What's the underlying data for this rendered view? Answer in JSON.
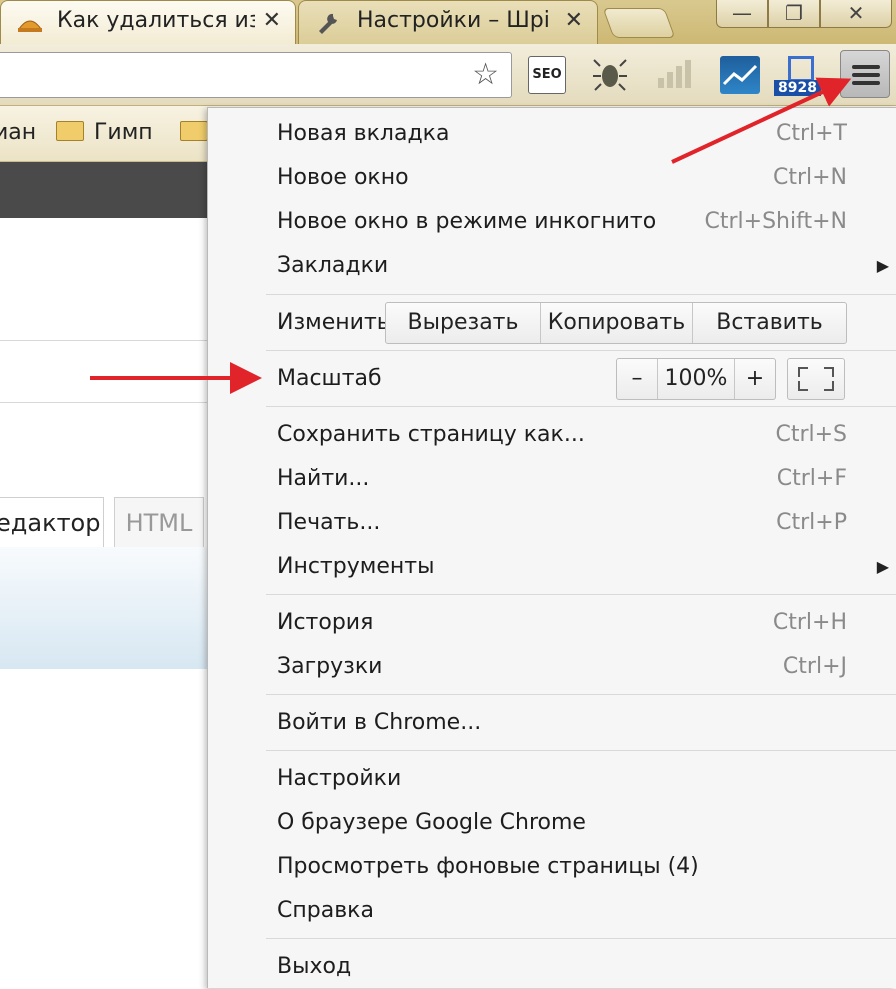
{
  "browser": {
    "tabs": [
      {
        "title": "Как удалиться из",
        "close": "✕",
        "active": true,
        "icon": "hat-favicon-icon"
      },
      {
        "title": "Настройки – Шрі",
        "close": "✕",
        "active": false,
        "icon": "wrench-icon"
      }
    ],
    "window_controls": {
      "minimize": "—",
      "restore": "❐",
      "close": "✕"
    }
  },
  "toolbar": {
    "extensions": [
      {
        "name": "seo-extension-icon",
        "label": "SEO"
      },
      {
        "name": "bug-extension-icon"
      },
      {
        "name": "signal-bars-extension-icon"
      },
      {
        "name": "chart-extension-icon"
      },
      {
        "name": "counter-extension-icon",
        "badge": "8928"
      }
    ]
  },
  "bookmarks": [
    {
      "label": "иан",
      "icon": ""
    },
    {
      "label": "Гимп",
      "icon": "folder-icon"
    },
    {
      "label": "",
      "icon": "folder-icon"
    }
  ],
  "page_behind": {
    "editor_tabs": [
      "едактор",
      "HTML"
    ]
  },
  "menu": {
    "new_tab": {
      "label": "Новая вкладка",
      "shortcut": "Ctrl+T"
    },
    "new_window": {
      "label": "Новое окно",
      "shortcut": "Ctrl+N"
    },
    "incognito": {
      "label": "Новое окно в режиме инкогнито",
      "shortcut": "Ctrl+Shift+N"
    },
    "bookmarks": {
      "label": "Закладки"
    },
    "edit": {
      "label": "Изменить",
      "cut": "Вырезать",
      "copy": "Копировать",
      "paste": "Вставить"
    },
    "zoom": {
      "label": "Масштаб",
      "minus": "–",
      "value": "100%",
      "plus": "+"
    },
    "save": {
      "label": "Сохранить страницу как...",
      "shortcut": "Ctrl+S"
    },
    "find": {
      "label": "Найти...",
      "shortcut": "Ctrl+F"
    },
    "print": {
      "label": "Печать...",
      "shortcut": "Ctrl+P"
    },
    "tools": {
      "label": "Инструменты"
    },
    "history": {
      "label": "История",
      "shortcut": "Ctrl+H"
    },
    "downloads": {
      "label": "Загрузки",
      "shortcut": "Ctrl+J"
    },
    "signin": {
      "label": "Войти в Chrome..."
    },
    "settings": {
      "label": "Настройки"
    },
    "about": {
      "label": "О браузере Google Chrome"
    },
    "background_pages": {
      "label": "Просмотреть фоновые страницы (4)"
    },
    "help": {
      "label": "Справка"
    },
    "exit": {
      "label": "Выход"
    }
  },
  "colors": {
    "annotation_arrow": "#e0242a",
    "tab_strip": "#d3c283"
  }
}
